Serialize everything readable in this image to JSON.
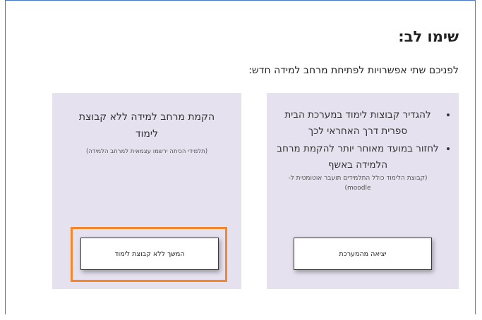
{
  "notice": {
    "title": "שימו לב:",
    "subtitle": "לפניכם שתי אפשרויות לפתיחת מרחב למידה חדש:"
  },
  "option_exit": {
    "bullets": [
      "להגדיר קבוצות לימוד במערכת הבית ספרית דרך האחראי לכך",
      "לחזור במועד מאוחר יותר להקמת מרחב הלמידה באשף"
    ],
    "note": "(קבוצת הלימוד כולל התלמידים תועבר אוטומטית ל- moodle)",
    "button_label": "יציאה מהמערכת"
  },
  "option_continue": {
    "heading": "הקמת מרחב למידה ללא קבוצת לימוד",
    "note": "(תלמידי הכיתה ירשמו עצמאית למרחב הלמידה)",
    "button_label": "המשך ללא קבוצת לימוד"
  },
  "colors": {
    "card_background": "#e6e1ef",
    "highlight_border": "#f5862a",
    "frame_border": "#4a78c8"
  }
}
